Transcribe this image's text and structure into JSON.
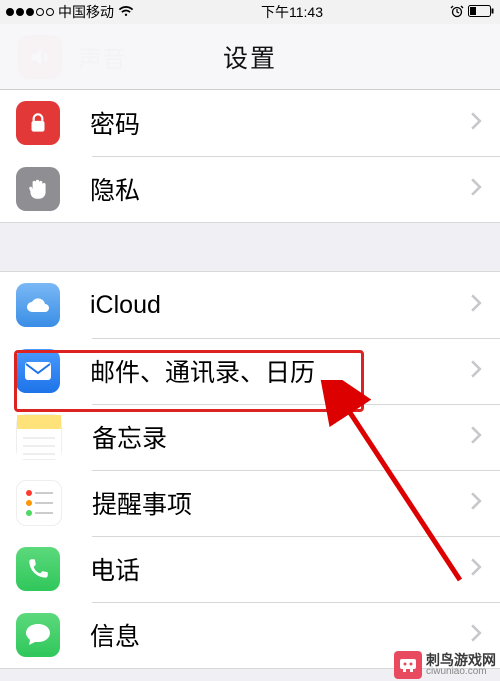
{
  "status": {
    "signal_filled": 3,
    "carrier": "中国移动",
    "time": "下午11:43"
  },
  "overlay": {
    "title": "设置",
    "faded_label": "声音"
  },
  "groups": [
    {
      "rows": [
        {
          "id": "password",
          "label": "密码",
          "icon": "lock",
          "bg": "#e23838",
          "fg": "#fff"
        },
        {
          "id": "privacy",
          "label": "隐私",
          "icon": "hand",
          "bg": "#8e8e93",
          "fg": "#fff"
        }
      ]
    },
    {
      "rows": [
        {
          "id": "icloud",
          "label": "iCloud",
          "icon": "cloud",
          "bg": "#3a8ee6",
          "fg": "#fff"
        },
        {
          "id": "mail",
          "label": "邮件、通讯录、日历",
          "icon": "mail",
          "bg": "#1e73e8",
          "fg": "#fff",
          "highlighted": true
        },
        {
          "id": "notes",
          "label": "备忘录",
          "icon": "notes",
          "bg": "#ffe27a",
          "fg": "#b58a2b"
        },
        {
          "id": "reminders",
          "label": "提醒事项",
          "icon": "reminders",
          "bg": "#ffffff",
          "fg": "#555"
        },
        {
          "id": "phone",
          "label": "电话",
          "icon": "phone",
          "bg": "#30c75b",
          "fg": "#fff"
        },
        {
          "id": "messages",
          "label": "信息",
          "icon": "message",
          "bg": "#30c75b",
          "fg": "#fff"
        }
      ]
    }
  ],
  "watermark": {
    "name": "刺鸟游戏网",
    "url": "ciwuniao.com"
  }
}
